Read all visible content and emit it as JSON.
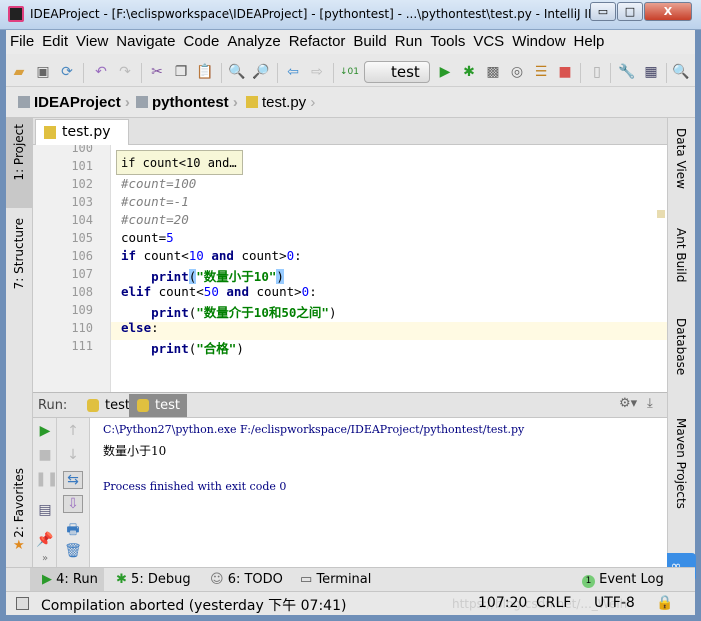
{
  "window": {
    "title": "IDEAProject - [F:\\eclispworkspace\\IDEAProject] - [pythontest] - ...\\pythontest\\test.py - IntelliJ ID...",
    "min": "▭",
    "max": "□",
    "close": "X"
  },
  "menu": [
    "File",
    "Edit",
    "View",
    "Navigate",
    "Code",
    "Analyze",
    "Refactor",
    "Build",
    "Run",
    "Tools",
    "VCS",
    "Window",
    "Help"
  ],
  "toolbar": {
    "run_config": "test"
  },
  "breadcrumb": [
    "IDEAProject",
    "pythontest",
    "test.py"
  ],
  "left_tools": [
    "1: Project",
    "7: Structure",
    "2: Favorites"
  ],
  "right_tools": [
    "Data View",
    "Ant Build",
    "Database",
    "Maven Projects"
  ],
  "editor": {
    "tab": "test.py",
    "tooltip": "if count<10 and…",
    "current_line": 107,
    "lines": [
      {
        "n": "100",
        "html": ""
      },
      {
        "n": "101",
        "html": ""
      },
      {
        "n": "102",
        "html": "<span class='cm'>#count=100</span>"
      },
      {
        "n": "103",
        "html": "<span class='cm'>#count=-1</span>"
      },
      {
        "n": "104",
        "html": "<span class='cm'>#count=20</span>"
      },
      {
        "n": "105",
        "html": "count=<span class='num'>5</span>"
      },
      {
        "n": "106",
        "html": "<span class='kw'>if</span> count&lt;<span class='num'>10</span> <span class='kw'>and</span> count&gt;<span class='num'>0</span>:"
      },
      {
        "n": "107",
        "html": "    <span class='kw'>print</span><span style='background:#99ccff'>(</span><span class='str'>\"数量小于10\"</span><span style='background:#99ccff'>)</span>"
      },
      {
        "n": "108",
        "html": "<span class='kw'>elif</span> count&lt;<span class='num'>50</span> <span class='kw'>and</span> count&gt;<span class='num'>0</span>:"
      },
      {
        "n": "109",
        "html": "    <span class='kw'>print</span>(<span class='str'>\"数量介于10和50之间\"</span>)"
      },
      {
        "n": "110",
        "html": "<span class='kw'>else</span>:"
      },
      {
        "n": "111",
        "html": "    <span class='kw'>print</span>(<span class='str'>\"合格\"</span>)"
      }
    ]
  },
  "run": {
    "label": "Run:",
    "tabs": [
      "test",
      "test"
    ],
    "output": [
      {
        "text": "C:\\Python27\\python.exe F:/eclispworkspace/IDEAProject/pythontest/test.py",
        "color": "#000080"
      },
      {
        "text": "数量小于10",
        "color": "#000000"
      },
      {
        "text": "",
        "color": "#000000"
      },
      {
        "text": "Process finished with exit code 0",
        "color": "#000080"
      }
    ]
  },
  "bottom_tabs": [
    "4: Run",
    "5: Debug",
    "6: TODO",
    "Terminal",
    "Event Log"
  ],
  "event_count": "1",
  "status": {
    "message": "Compilation aborted (yesterday 下午 07:41)",
    "position": "107:20",
    "line_sep": "CRLF",
    "encoding": "UTF-8",
    "watermark": "https://blog.csdn.net/..._Weih"
  }
}
